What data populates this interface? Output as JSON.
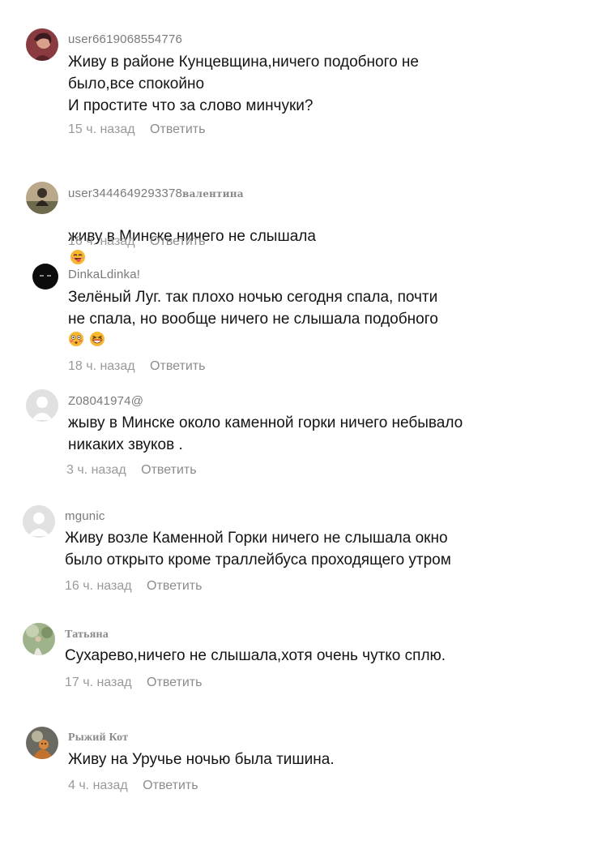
{
  "reply_label": "Ответить",
  "comments": [
    {
      "username": "user6619068554776",
      "text": "Живу в районе Кунцевщина,ничего подобного не\nбыло,все спокойно\nИ простите что за слово минчуки?",
      "time": "15 ч. назад"
    },
    {
      "username": "user3444649293378",
      "username_suffix": "валентина",
      "text": "живу в Минске ничего не слышала",
      "emojis": [
        "smiling-face-with-tongue-emoji"
      ],
      "time": "16 ч. назад"
    },
    {
      "username": "DinkaLdinka!",
      "text": "Зелёный Луг. так плохо ночью сегодня спала, почти\nне спала, но вообще ничего не слышала подобного",
      "emojis": [
        "flushed-face-emoji",
        "grinning-squinting-face-emoji"
      ],
      "time": "18 ч. назад"
    },
    {
      "username": "Z08041974@",
      "text": "жыву в Минске около каменной горки ничего небывало\nникаких звуков .",
      "time": "3 ч. назад"
    },
    {
      "username": "mgunic",
      "text": "Живу возле Каменной Горки ничего не слышала окно\nбыло открыто кроме траллейбуса проходящего утром",
      "time": "16 ч. назад"
    },
    {
      "username": "Татьяна",
      "text": "Сухарево,ничего не слышала,хотя очень чутко сплю.",
      "time": "17 ч. назад"
    },
    {
      "username": "Рыжий Кот",
      "text": "Живу на Уручье ночью была тишина.",
      "time": "4 ч. назад"
    }
  ]
}
